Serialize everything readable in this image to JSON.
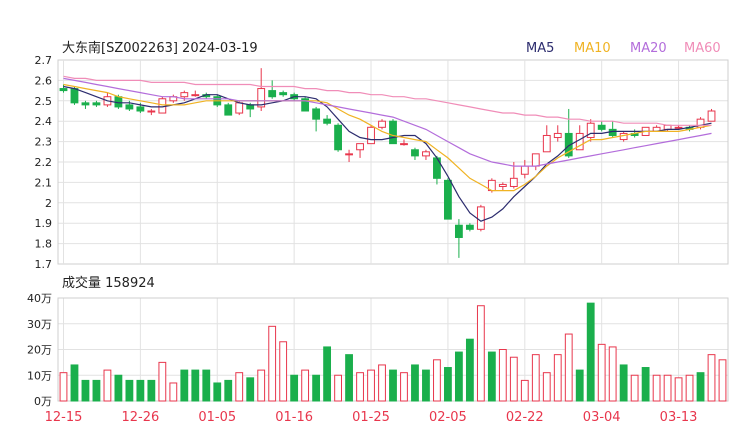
{
  "header": {
    "title": "大东南[SZ002263] 2024-03-19",
    "ma_legend": [
      {
        "label": "MA5",
        "color": "#2c2c6e"
      },
      {
        "label": "MA10",
        "color": "#f0b323"
      },
      {
        "label": "MA20",
        "color": "#b36ddb"
      },
      {
        "label": "MA60",
        "color": "#f08db8"
      }
    ]
  },
  "volume_panel": {
    "title": "成交量 158924"
  },
  "colors": {
    "up": "#e8364c",
    "down": "#1aaf4c",
    "grid": "#e2e2e2",
    "axis_text": "#222222",
    "date_text": "#e8364c"
  },
  "chart_data": [
    {
      "type": "candlestick",
      "title": "",
      "ylim": [
        1.7,
        2.7
      ],
      "y_ticks": [
        "2.7",
        "2.6",
        "2.5",
        "2.4",
        "2.3",
        "2.2",
        "2.1",
        "2",
        "1.9",
        "1.8",
        "1.7"
      ],
      "x_ticks": [
        "12-15",
        "12-26",
        "01-05",
        "01-16",
        "01-25",
        "02-05",
        "02-22",
        "03-04",
        "03-13"
      ],
      "x_tick_index": [
        0,
        7,
        14,
        21,
        28,
        35,
        42,
        49,
        56
      ],
      "ohlc": [
        [
          2.56,
          2.58,
          2.54,
          2.55
        ],
        [
          2.56,
          2.57,
          2.48,
          2.49
        ],
        [
          2.49,
          2.5,
          2.46,
          2.48
        ],
        [
          2.49,
          2.5,
          2.47,
          2.48
        ],
        [
          2.48,
          2.54,
          2.47,
          2.52
        ],
        [
          2.52,
          2.53,
          2.46,
          2.47
        ],
        [
          2.48,
          2.5,
          2.45,
          2.46
        ],
        [
          2.47,
          2.49,
          2.44,
          2.45
        ],
        [
          2.45,
          2.46,
          2.43,
          2.45
        ],
        [
          2.44,
          2.52,
          2.44,
          2.51
        ],
        [
          2.5,
          2.53,
          2.49,
          2.52
        ],
        [
          2.52,
          2.55,
          2.5,
          2.54
        ],
        [
          2.53,
          2.55,
          2.52,
          2.53
        ],
        [
          2.53,
          2.54,
          2.51,
          2.52
        ],
        [
          2.52,
          2.53,
          2.47,
          2.48
        ],
        [
          2.48,
          2.49,
          2.43,
          2.43
        ],
        [
          2.44,
          2.5,
          2.43,
          2.49
        ],
        [
          2.48,
          2.49,
          2.42,
          2.46
        ],
        [
          2.47,
          2.66,
          2.45,
          2.56
        ],
        [
          2.55,
          2.6,
          2.51,
          2.52
        ],
        [
          2.54,
          2.55,
          2.52,
          2.53
        ],
        [
          2.53,
          2.54,
          2.5,
          2.51
        ],
        [
          2.51,
          2.52,
          2.45,
          2.45
        ],
        [
          2.46,
          2.47,
          2.35,
          2.41
        ],
        [
          2.41,
          2.43,
          2.38,
          2.39
        ],
        [
          2.38,
          2.39,
          2.25,
          2.26
        ],
        [
          2.24,
          2.26,
          2.2,
          2.24
        ],
        [
          2.26,
          2.29,
          2.22,
          2.29
        ],
        [
          2.29,
          2.38,
          2.29,
          2.37
        ],
        [
          2.37,
          2.41,
          2.36,
          2.4
        ],
        [
          2.4,
          2.41,
          2.29,
          2.29
        ],
        [
          2.29,
          2.31,
          2.28,
          2.29
        ],
        [
          2.26,
          2.27,
          2.21,
          2.23
        ],
        [
          2.23,
          2.26,
          2.21,
          2.25
        ],
        [
          2.22,
          2.23,
          2.09,
          2.12
        ],
        [
          2.11,
          2.12,
          1.92,
          1.92
        ],
        [
          1.89,
          1.92,
          1.73,
          1.83
        ],
        [
          1.89,
          1.9,
          1.86,
          1.87
        ],
        [
          1.87,
          1.99,
          1.86,
          1.98
        ],
        [
          2.06,
          2.12,
          2.05,
          2.11
        ],
        [
          2.08,
          2.1,
          2.06,
          2.09
        ],
        [
          2.08,
          2.2,
          2.07,
          2.12
        ],
        [
          2.14,
          2.21,
          2.12,
          2.18
        ],
        [
          2.18,
          2.24,
          2.16,
          2.24
        ],
        [
          2.25,
          2.38,
          2.25,
          2.33
        ],
        [
          2.32,
          2.38,
          2.3,
          2.34
        ],
        [
          2.34,
          2.46,
          2.22,
          2.23
        ],
        [
          2.26,
          2.38,
          2.26,
          2.34
        ],
        [
          2.32,
          2.41,
          2.3,
          2.39
        ],
        [
          2.38,
          2.4,
          2.35,
          2.36
        ],
        [
          2.36,
          2.4,
          2.32,
          2.33
        ],
        [
          2.31,
          2.35,
          2.3,
          2.34
        ],
        [
          2.34,
          2.36,
          2.32,
          2.33
        ],
        [
          2.33,
          2.37,
          2.33,
          2.37
        ],
        [
          2.35,
          2.38,
          2.35,
          2.37
        ],
        [
          2.36,
          2.38,
          2.35,
          2.38
        ],
        [
          2.37,
          2.38,
          2.36,
          2.37
        ],
        [
          2.37,
          2.38,
          2.35,
          2.36
        ],
        [
          2.37,
          2.42,
          2.36,
          2.41
        ],
        [
          2.4,
          2.46,
          2.4,
          2.45
        ]
      ],
      "series": [
        {
          "name": "MA5",
          "values": [
            2.57,
            2.56,
            2.54,
            2.52,
            2.5,
            2.49,
            2.49,
            2.48,
            2.47,
            2.47,
            2.48,
            2.49,
            2.51,
            2.53,
            2.53,
            2.51,
            2.49,
            2.48,
            2.48,
            2.49,
            2.5,
            2.52,
            2.52,
            2.51,
            2.47,
            2.41,
            2.35,
            2.32,
            2.31,
            2.31,
            2.32,
            2.33,
            2.33,
            2.29,
            2.22,
            2.13,
            2.03,
            1.95,
            1.91,
            1.93,
            1.97,
            2.03,
            2.08,
            2.13,
            2.19,
            2.23,
            2.28,
            2.31,
            2.34,
            2.34,
            2.35,
            2.35,
            2.35,
            2.35,
            2.35,
            2.36,
            2.36,
            2.37,
            2.38,
            2.39
          ]
        },
        {
          "name": "MA10",
          "values": [
            2.58,
            2.57,
            2.56,
            2.55,
            2.54,
            2.52,
            2.51,
            2.5,
            2.49,
            2.48,
            2.48,
            2.48,
            2.49,
            2.5,
            2.5,
            2.5,
            2.5,
            2.5,
            2.5,
            2.5,
            2.5,
            2.5,
            2.5,
            2.5,
            2.49,
            2.46,
            2.43,
            2.41,
            2.38,
            2.35,
            2.33,
            2.32,
            2.31,
            2.3,
            2.26,
            2.22,
            2.17,
            2.12,
            2.09,
            2.06,
            2.06,
            2.06,
            2.09,
            2.13,
            2.18,
            2.22,
            2.25,
            2.28,
            2.31,
            2.31,
            2.32,
            2.33,
            2.34,
            2.35,
            2.35,
            2.35,
            2.35,
            2.36,
            2.37,
            2.38
          ]
        },
        {
          "name": "MA20",
          "values": [
            2.61,
            2.6,
            2.59,
            2.58,
            2.57,
            2.56,
            2.55,
            2.54,
            2.53,
            2.52,
            2.52,
            2.51,
            2.51,
            2.51,
            2.51,
            2.51,
            2.5,
            2.5,
            2.5,
            2.5,
            2.5,
            2.5,
            2.5,
            2.49,
            2.48,
            2.47,
            2.46,
            2.45,
            2.44,
            2.43,
            2.42,
            2.4,
            2.38,
            2.36,
            2.33,
            2.3,
            2.27,
            2.24,
            2.22,
            2.2,
            2.19,
            2.18,
            2.18,
            2.18,
            2.19,
            2.2,
            2.21,
            2.22,
            2.23,
            2.24,
            2.25,
            2.26,
            2.27,
            2.28,
            2.29,
            2.3,
            2.31,
            2.32,
            2.33,
            2.34
          ]
        },
        {
          "name": "MA60",
          "values": [
            2.62,
            2.61,
            2.61,
            2.6,
            2.6,
            2.6,
            2.6,
            2.6,
            2.59,
            2.59,
            2.59,
            2.59,
            2.58,
            2.58,
            2.58,
            2.58,
            2.58,
            2.58,
            2.57,
            2.57,
            2.57,
            2.57,
            2.56,
            2.56,
            2.55,
            2.55,
            2.54,
            2.54,
            2.53,
            2.53,
            2.52,
            2.52,
            2.51,
            2.51,
            2.5,
            2.49,
            2.48,
            2.47,
            2.46,
            2.45,
            2.44,
            2.44,
            2.43,
            2.43,
            2.42,
            2.42,
            2.41,
            2.41,
            2.4,
            2.4,
            2.4,
            2.39,
            2.39,
            2.39,
            2.39,
            2.38,
            2.38,
            2.38,
            2.38,
            2.38
          ]
        }
      ]
    },
    {
      "type": "bar",
      "title": "成交量 158924",
      "ylim": [
        0,
        40
      ],
      "y_ticks": [
        "40万",
        "30万",
        "20万",
        "10万",
        "0万"
      ],
      "values": [
        11,
        14,
        8,
        8,
        12,
        10,
        8,
        8,
        8,
        15,
        7,
        12,
        12,
        12,
        7,
        8,
        11,
        9,
        12,
        29,
        23,
        10,
        12,
        10,
        21,
        10,
        18,
        11,
        12,
        14,
        12,
        11,
        14,
        12,
        16,
        13,
        19,
        24,
        37,
        19,
        20,
        17,
        8,
        18,
        11,
        18,
        26,
        12,
        38,
        22,
        21,
        14,
        10,
        13,
        10,
        10,
        9,
        10,
        11,
        18,
        16
      ],
      "up": [
        1,
        0,
        0,
        0,
        1,
        0,
        0,
        0,
        0,
        1,
        1,
        0,
        0,
        0,
        0,
        0,
        1,
        0,
        1,
        1,
        1,
        0,
        1,
        0,
        0,
        1,
        0,
        1,
        1,
        1,
        0,
        1,
        0,
        0,
        1,
        0,
        0,
        0,
        1,
        0,
        1,
        1,
        1,
        1,
        1,
        1,
        1,
        0,
        0,
        1,
        1,
        0,
        1,
        0,
        1,
        1,
        1,
        1,
        0,
        1,
        1
      ]
    }
  ]
}
